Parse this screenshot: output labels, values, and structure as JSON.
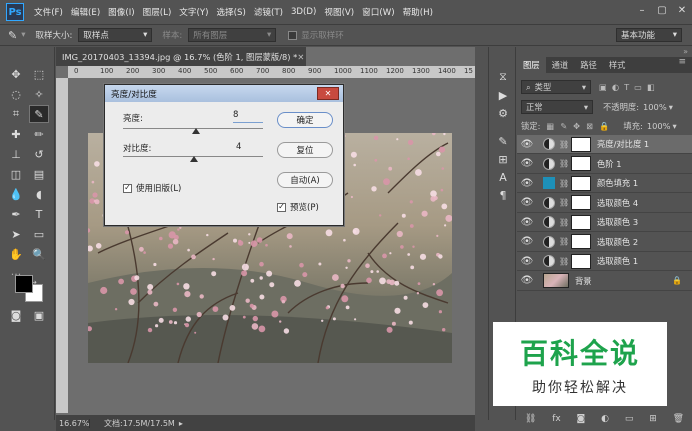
{
  "app": {
    "logo": "Ps"
  },
  "menu": [
    "文件(F)",
    "编辑(E)",
    "图像(I)",
    "图层(L)",
    "文字(Y)",
    "选择(S)",
    "滤镜(T)",
    "3D(D)",
    "视图(V)",
    "窗口(W)",
    "帮助(H)"
  ],
  "options": {
    "sample_size_label": "取样大小:",
    "sample_size_value": "取样点",
    "sample_label": "样本:",
    "sample_value": "所有图层",
    "show_ring": "显示取样环",
    "workspace": "基本功能"
  },
  "document": {
    "tab_title": "IMG_20170403_13394.jpg @ 16.7% (色阶 1, 图层蒙版/8) *",
    "ruler_marks": [
      "0",
      "100",
      "200",
      "300",
      "400",
      "500",
      "600",
      "700",
      "800",
      "900",
      "1000",
      "1100",
      "1200",
      "1300",
      "1400",
      "15"
    ],
    "zoom": "16.67%",
    "doc_info": "文档:17.5M/17.5M"
  },
  "dialog": {
    "title": "亮度/对比度",
    "brightness_label": "亮度:",
    "brightness_value": "8",
    "brightness_level": 0.52,
    "contrast_label": "对比度:",
    "contrast_value": "4",
    "contrast_level": 0.51,
    "ok": "确定",
    "reset": "复位",
    "auto": "自动(A)",
    "legacy": "使用旧版(L)",
    "preview": "预览(P)"
  },
  "panel": {
    "tabs": [
      "图层",
      "通道",
      "路径",
      "样式"
    ],
    "kind_filter": "类型",
    "blend_mode": "正常",
    "opacity_label": "不透明度:",
    "opacity_value": "100%",
    "lock_label": "锁定:",
    "fill_label": "填充:",
    "fill_value": "100%"
  },
  "layers": [
    {
      "name": "亮度/对比度 1",
      "type": "adjustment",
      "selected": true
    },
    {
      "name": "色阶 1",
      "type": "adjustment",
      "selected": false
    },
    {
      "name": "颜色填充 1",
      "type": "fill",
      "selected": false
    },
    {
      "name": "选取颜色 4",
      "type": "adjustment",
      "selected": false
    },
    {
      "name": "选取颜色 3",
      "type": "adjustment",
      "selected": false
    },
    {
      "name": "选取颜色 2",
      "type": "adjustment",
      "selected": false
    },
    {
      "name": "选取颜色 1",
      "type": "adjustment",
      "selected": false
    },
    {
      "name": "背景",
      "type": "background",
      "selected": false
    }
  ],
  "watermark": {
    "big": "百科全说",
    "small": "助你轻松解决"
  },
  "colors": {
    "accent": "#31a8ff",
    "fill_swatch": "#1e90b8",
    "watermark_green": "#1ea34c"
  }
}
